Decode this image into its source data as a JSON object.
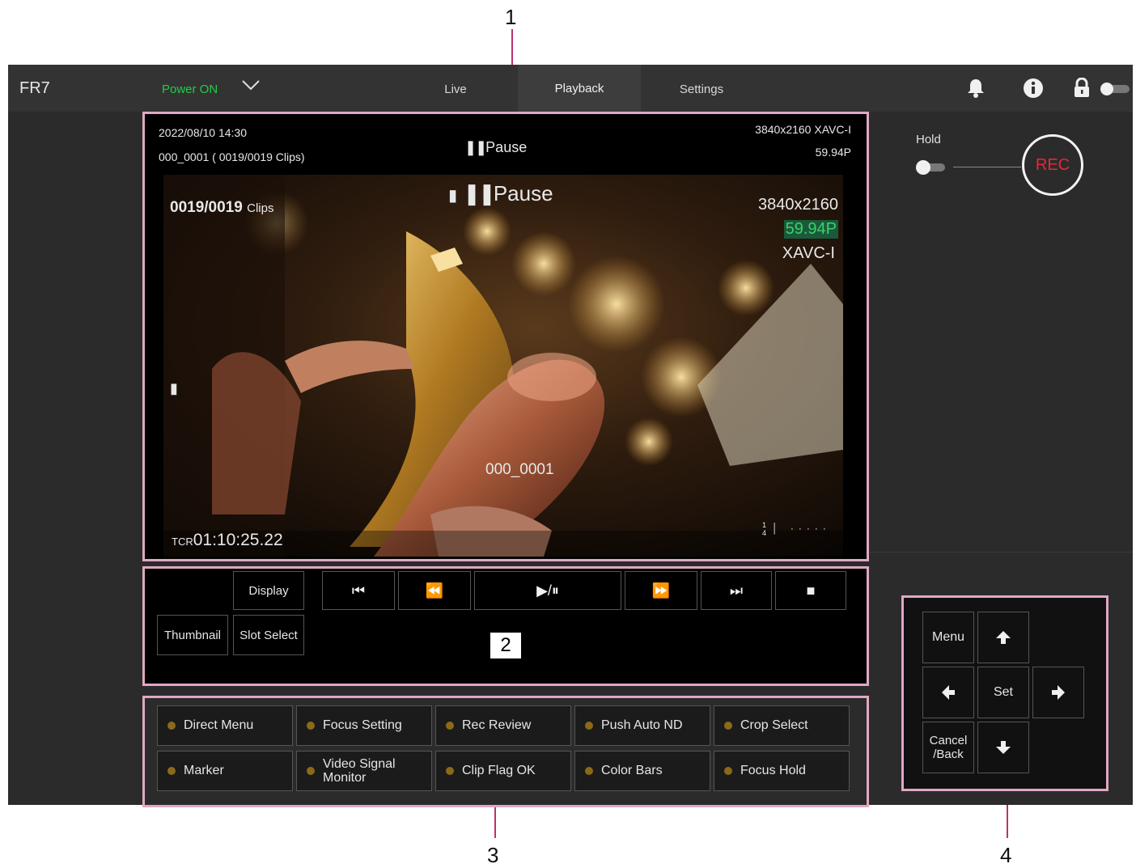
{
  "callouts": {
    "c1": "1",
    "c2": "2",
    "c3": "3",
    "c4": "4"
  },
  "app": {
    "name": "FR7",
    "power_label": "Power ON",
    "tabs": [
      {
        "label": "Live",
        "active": false
      },
      {
        "label": "Playback",
        "active": true
      },
      {
        "label": "Settings",
        "active": false
      }
    ],
    "icons": [
      "bell-icon",
      "info-icon",
      "lock-icon",
      "toggle-icon"
    ]
  },
  "viewer": {
    "datetime": "2022/08/10 14:30",
    "clip_info": "000_0001 ( 0019/0019 Clips)",
    "status": "Pause",
    "format_top": "3840x2160 XAVC-I",
    "framerate_top": "59.94P",
    "osd": {
      "clip_count": "0019/0019",
      "clip_count_unit": "Clips",
      "status": "Pause",
      "resolution": "3840x2160",
      "framerate": "59.94P",
      "codec": "XAVC-I",
      "clip_name": "000_0001",
      "tc_prefix": "TCR",
      "timecode": "01:10:25.22",
      "slot_top": "1",
      "slot_bottom": "4"
    }
  },
  "rec_panel": {
    "hold_label": "Hold",
    "rec_label": "REC"
  },
  "playback_controls": {
    "display": "Display",
    "thumbnail": "Thumbnail",
    "slot_select": "Slot Select",
    "transport": [
      "⏮",
      "⏪",
      "▶/⏸",
      "⏩",
      "⏭",
      "■"
    ]
  },
  "assign_buttons": [
    "Direct Menu",
    "Focus Setting",
    "Rec Review",
    "Push Auto ND",
    "Crop Select",
    "Marker",
    "Video Signal Monitor",
    "Clip Flag OK",
    "Color Bars",
    "Focus Hold"
  ],
  "nav_pad": {
    "menu": "Menu",
    "set": "Set",
    "cancel": "Cancel /Back"
  }
}
